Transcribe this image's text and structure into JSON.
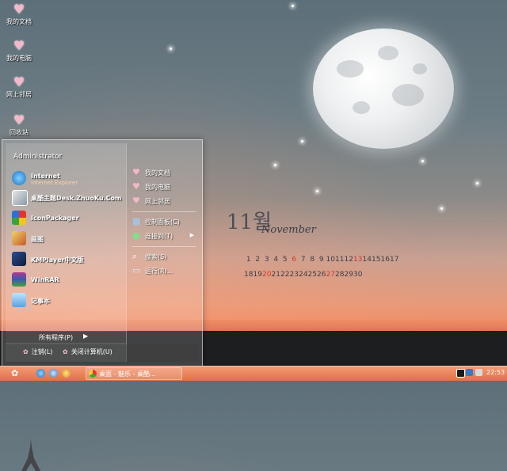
{
  "desktop_icons": [
    {
      "label": "我的文档",
      "icon": "heart-icon"
    },
    {
      "label": "我的电脑",
      "icon": "heart-icon"
    },
    {
      "label": "网上邻居",
      "icon": "heart-icon"
    },
    {
      "label": "回收站",
      "icon": "heart-icon"
    }
  ],
  "calendar": {
    "month_number": "11월",
    "month_name": "November",
    "row1": [
      "1",
      "2",
      "3",
      "4",
      "5",
      "6",
      "7",
      "8",
      "9",
      "10",
      "11",
      "12",
      "13",
      "14",
      "15",
      "16",
      "17"
    ],
    "row2": [
      "18",
      "19",
      "20",
      "21",
      "22",
      "23",
      "24",
      "25",
      "26",
      "27",
      "28",
      "29",
      "30"
    ],
    "highlight_color": "#cf3a2c"
  },
  "start_menu": {
    "user": "Administrator",
    "pinned": [
      {
        "title": "Internet",
        "subtitle": "Internet Explorer",
        "icon": "ie-icon"
      },
      {
        "title": "桌酷主题Desk.ZhuoKu.Com",
        "icon": "theme-icon"
      }
    ],
    "recent": [
      {
        "title": "IconPackager",
        "icon": "iconpackager-icon"
      },
      {
        "title": "画图",
        "icon": "paint-icon"
      },
      {
        "title": "KMPlayer中文版",
        "icon": "kmplayer-icon"
      },
      {
        "title": "WinRAR",
        "icon": "winrar-icon"
      },
      {
        "title": "记事本",
        "icon": "notepad-icon"
      }
    ],
    "all_programs": "所有程序(P)",
    "right": [
      {
        "label": "我的文档",
        "icon": "heart-icon"
      },
      {
        "label": "我的电脑",
        "icon": "heart-icon"
      },
      {
        "label": "网上邻居",
        "icon": "heart-icon"
      },
      {
        "label": "控制面板(C)",
        "icon": "control-panel-icon"
      },
      {
        "label": "连接到(T)",
        "icon": "connect-icon"
      },
      {
        "label": "搜索(S)",
        "icon": "search-icon"
      },
      {
        "label": "运行(R)...",
        "icon": "run-icon"
      }
    ],
    "logoff": "注销(L)",
    "shutdown": "关闭计算机(U)"
  },
  "taskbar": {
    "task_item": "桌面 - 魅乐 - 桌酷...",
    "clock": "22:53"
  },
  "colors": {
    "accent": "#f08c64",
    "taskbar": "#e0704b"
  }
}
